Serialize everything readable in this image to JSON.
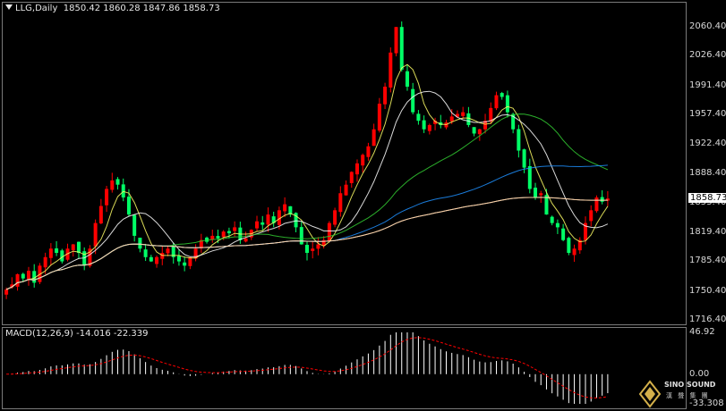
{
  "header": {
    "symbol": "LLG,Daily",
    "ohlc": "1850.42 1860.28 1847.86 1858.73"
  },
  "price_axis": {
    "ticks": [
      "2060.40",
      "2026.40",
      "1991.40",
      "1957.40",
      "1922.40",
      "1888.40",
      "1853.40",
      "1819.40",
      "1785.40",
      "1750.40",
      "1716.40"
    ],
    "current_price": "1858.73"
  },
  "macd": {
    "title": "MACD(12,26,9) -14.016 -22.339",
    "ticks": [
      "46.92",
      "0.00",
      "-33.308"
    ]
  },
  "logo": {
    "name": "SINO SOUND",
    "sub": "漢 聲 集 團"
  },
  "colors": {
    "bull": "#ff0000",
    "bear": "#00ff66",
    "ma5": "#ffff66",
    "ma10": "#ffffff",
    "ma30": "#33cc33",
    "ma60": "#1e90ff",
    "ma120": "#ffffff",
    "ma250": "#ffcc99",
    "macd_hist": "#ffffff",
    "macd_signal": "#ff0000"
  },
  "chart_data": {
    "type": "candlestick",
    "title": "LLG,Daily",
    "ylim": [
      1716.4,
      2077
    ],
    "last_close": 1858.73,
    "closes": [
      1752,
      1758,
      1770,
      1765,
      1774,
      1760,
      1780,
      1790,
      1800,
      1795,
      1785,
      1800,
      1805,
      1795,
      1780,
      1800,
      1830,
      1850,
      1870,
      1880,
      1875,
      1860,
      1840,
      1815,
      1800,
      1790,
      1785,
      1790,
      1795,
      1800,
      1790,
      1785,
      1780,
      1790,
      1800,
      1810,
      1808,
      1815,
      1812,
      1820,
      1818,
      1825,
      1810,
      1812,
      1822,
      1832,
      1828,
      1840,
      1830,
      1845,
      1852,
      1840,
      1825,
      1805,
      1795,
      1800,
      1805,
      1810,
      1830,
      1845,
      1865,
      1875,
      1890,
      1900,
      1910,
      1920,
      1940,
      1970,
      1990,
      2030,
      2060,
      2010,
      1990,
      1960,
      1950,
      1940,
      1945,
      1950,
      1945,
      1948,
      1955,
      1958,
      1960,
      1945,
      1935,
      1940,
      1950,
      1965,
      1980,
      1978,
      1960,
      1940,
      1915,
      1895,
      1870,
      1860,
      1865,
      1840,
      1830,
      1825,
      1810,
      1795,
      1800,
      1810,
      1830,
      1845,
      1860,
      1855,
      1858.73
    ],
    "ma_lines": [
      "MA5",
      "MA10",
      "MA30",
      "MA60",
      "MA120",
      "MA250"
    ],
    "macd": {
      "ylim": [
        -33.308,
        46.92
      ],
      "zero": 0.0
    }
  }
}
